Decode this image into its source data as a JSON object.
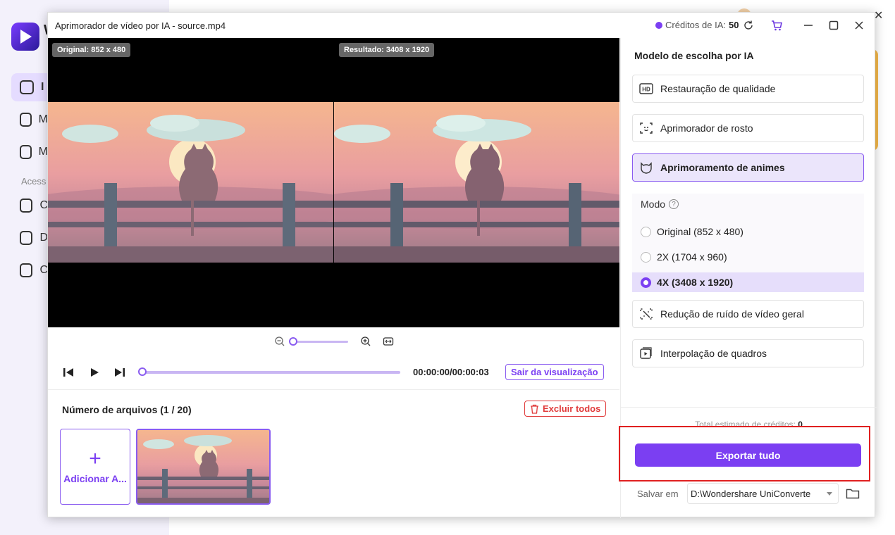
{
  "background_app": {
    "logo_text": "W",
    "nav": [
      "I",
      "M",
      "M",
      "C",
      "D",
      "C"
    ],
    "section_label": "Acess"
  },
  "dialog": {
    "title": "Aprimorador de vídeo por IA - source.mp4",
    "credits_label": "Créditos de IA:",
    "credits_value": "50"
  },
  "preview": {
    "original_badge": "Original: 852 x 480",
    "result_badge": "Resultado: 3408 x 1920"
  },
  "zoom": {
    "level": 0
  },
  "playback": {
    "time": "00:00:00/00:00:03",
    "exit_label": "Sair da visualização",
    "progress": 0
  },
  "files": {
    "count_label": "Número de arquivos (1 / 20)",
    "delete_all_label": "Excluir todos",
    "add_label": "Adicionar A..."
  },
  "right_panel": {
    "title": "Modelo de escolha por IA",
    "options": [
      {
        "label": "Restauração de qualidade",
        "icon": "hd-icon"
      },
      {
        "label": "Aprimorador de rosto",
        "icon": "face-scan-icon"
      },
      {
        "label": "Aprimoramento de animes",
        "icon": "anime-icon",
        "active": true
      },
      {
        "label": "Redução de ruído de vídeo geral",
        "icon": "denoise-icon"
      },
      {
        "label": "Interpolação de quadros",
        "icon": "frame-interpolation-icon"
      }
    ],
    "mode_label": "Modo",
    "modes": [
      {
        "label": "Original (852 x 480)",
        "selected": false
      },
      {
        "label": "2X (1704 x 960)",
        "selected": false
      },
      {
        "label": "4X (3408 x 1920)",
        "selected": true
      }
    ],
    "estimate_label": "Total estimado de créditos:",
    "estimate_value": "0",
    "export_label": "Exportar tudo",
    "save_label": "Salvar em",
    "save_path": "D:\\Wondershare UniConverte"
  },
  "colors": {
    "accent": "#7b3ff2",
    "danger": "#e03a3a",
    "highlight": "#e02020"
  }
}
